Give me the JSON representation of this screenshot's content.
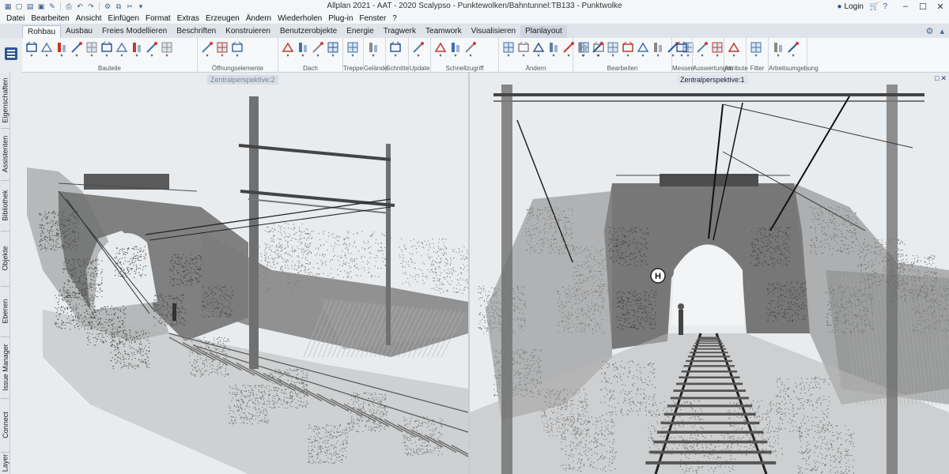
{
  "window": {
    "title": "Allplan 2021 - AAT - 2020 Scalypso - Punktewolken/Bahntunnel:TB133 - Punktwolke",
    "login_label": "Login",
    "controls": [
      "–",
      "☐",
      "✕"
    ]
  },
  "quick_access": [
    "new-icon",
    "open-icon",
    "save-icon",
    "edit-icon",
    "print-icon",
    "undo-icon",
    "redo-icon",
    "options-icon",
    "copy-icon",
    "tools-icon"
  ],
  "menu": [
    "Datei",
    "Bearbeiten",
    "Ansicht",
    "Einfügen",
    "Format",
    "Extras",
    "Erzeugen",
    "Ändern",
    "Wiederholen",
    "Plug-in",
    "Fenster",
    "?"
  ],
  "ribbon_tabs": [
    "Rohbau",
    "Ausbau",
    "Freies Modellieren",
    "Beschriften",
    "Konstruieren",
    "Benutzerobjekte",
    "Energie",
    "Tragwerk",
    "Teamwork",
    "Visualisieren",
    "Planlayout"
  ],
  "active_tab": "Rohbau",
  "ribbon_groups": [
    {
      "label": "Bauteile"
    },
    {
      "label": "Öffnungselemente"
    },
    {
      "label": "Dach"
    },
    {
      "label": "Treppe"
    },
    {
      "label": "Gelände"
    },
    {
      "label": "Schnitte"
    },
    {
      "label": "Update"
    },
    {
      "label": "Schnellzugriff"
    },
    {
      "label": "Ändern"
    },
    {
      "label": "Bearbeiten"
    },
    {
      "label": "Messen"
    },
    {
      "label": "Auswertungen"
    },
    {
      "label": "Attribute"
    },
    {
      "label": "Filter"
    },
    {
      "label": "Arbeitsumgebung"
    }
  ],
  "side_tabs": [
    "Eigenschaften",
    "Assistenten",
    "Bibliothek",
    "Objekte",
    "Ebenen",
    "Issue Manager",
    "Connect",
    "Layer"
  ],
  "viewports": {
    "left": {
      "label": "Zentralperspektive:2"
    },
    "right": {
      "label": "Zentralperspektive:1",
      "buttons": [
        "□",
        "✕"
      ]
    }
  },
  "scene": {
    "tunnel_sign": "H"
  },
  "colors": {
    "accent": "#2b5797",
    "ribbon_bg": "#f6f8fa",
    "viewport_bg": "#e9ecee",
    "pointcloud": "#555555"
  }
}
